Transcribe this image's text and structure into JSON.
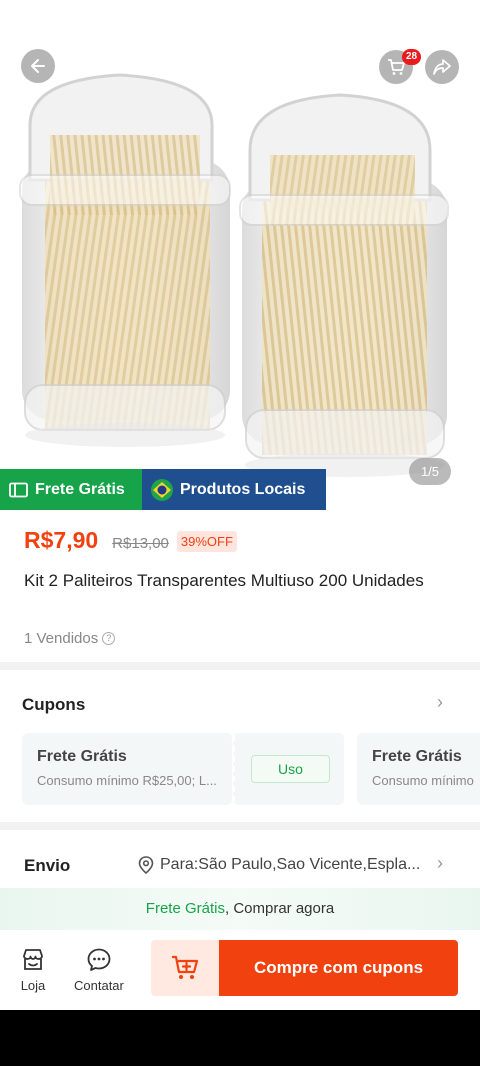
{
  "hero": {
    "cart_count": "28",
    "image_counter": "1/5"
  },
  "tags": {
    "free_shipping": "Frete Grátis",
    "local_products": "Produtos Locais"
  },
  "product": {
    "price": "R$7,90",
    "old_price": "R$13,00",
    "discount": "39%OFF",
    "title": "Kit 2 Paliteiros Transparentes Multiuso 200 Unidades",
    "sold": "1 Vendidos"
  },
  "coupons": {
    "title": "Cupons",
    "items": [
      {
        "title": "Frete Grátis",
        "subtitle": "Consumo mínimo R$25,00; L...",
        "action": "Uso"
      },
      {
        "title": "Frete Grátis",
        "subtitle": "Consumo mínimo"
      }
    ]
  },
  "shipping": {
    "title": "Envio",
    "destination": "Para:São Paulo,Sao Vicente,Espla..."
  },
  "promo": {
    "highlight": "Frete Grátis",
    "rest": ", Comprar agora"
  },
  "bottom": {
    "store_label": "Loja",
    "contact_label": "Contatar",
    "buy_label": "Compre com cupons"
  },
  "colors": {
    "accent": "#f0410e",
    "green": "#17a34a",
    "blue_tag": "#1f4f8f"
  },
  "icons": [
    "back-arrow-icon",
    "cart-icon",
    "share-icon",
    "ticket-icon",
    "brazil-flag-icon",
    "help-icon",
    "chevron-right-icon",
    "location-pin-icon",
    "store-icon",
    "chat-icon",
    "add-to-cart-icon"
  ]
}
